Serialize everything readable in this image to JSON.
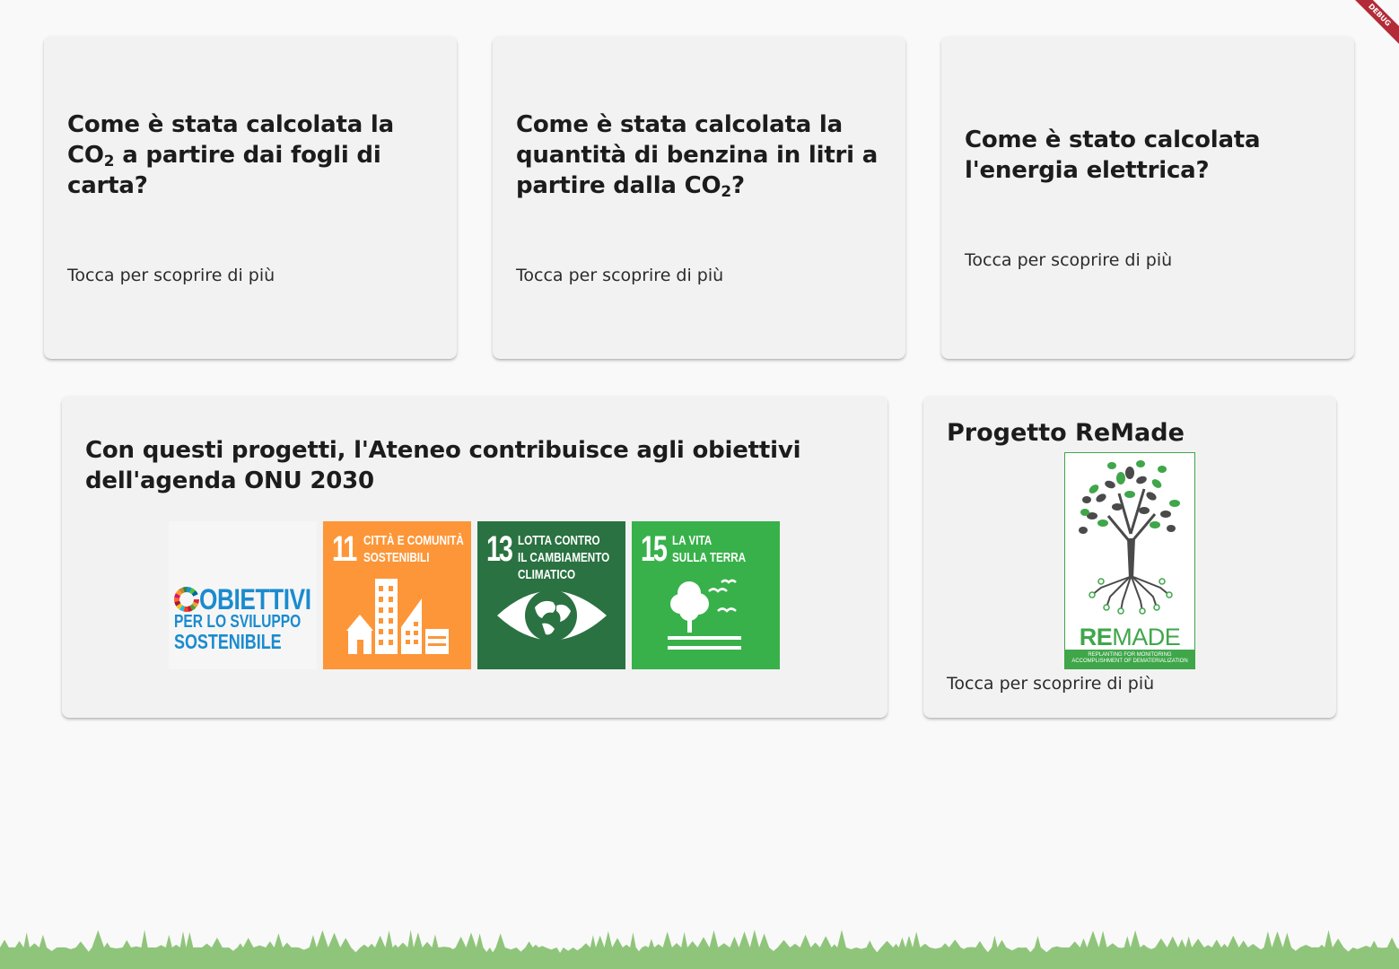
{
  "questions": [
    {
      "title": "Come è stata calcolata la CO",
      "subscript": "2",
      "title_rest": " a partire dai fogli di carta?",
      "cta": "Tocca per scoprire di più"
    },
    {
      "title": "Come è stata calcolata la quantità di benzina in litri a partire dalla CO",
      "subscript": "2",
      "title_rest": "?",
      "cta": "Tocca per scoprire di più"
    },
    {
      "title": "Come è stato calcolata l'energia elettrica?",
      "cta": "Tocca per scoprire di più"
    }
  ],
  "sdg": {
    "title": "Con questi progetti, l'Ateneo contribuisce agli obiettivi dell'agenda ONU 2030",
    "logo": {
      "line1": "OBIETTIVI",
      "line2": "PER LO SVILUPPO",
      "line3": "SOSTENIBILE"
    },
    "goals": [
      {
        "number": "11",
        "label1": "Città e comunità",
        "label2": "sostenibili",
        "color": "#fd9638",
        "icon": "city-icon"
      },
      {
        "number": "13",
        "label1": "Lotta contro",
        "label2": "il cambiamento",
        "label3": "climatico",
        "color": "#2a7241",
        "icon": "eye-globe-icon"
      },
      {
        "number": "15",
        "label1": "La vita",
        "label2": "sulla terra",
        "color": "#38b14a",
        "icon": "tree-birds-icon"
      }
    ]
  },
  "remade": {
    "title": "Progetto ReMade",
    "logo_word_bold": "RE",
    "logo_word_light": "MADE",
    "logo_tagline1": "Replanting for monitoring",
    "logo_tagline2": "accomplishment of dematerialization",
    "cta": "Tocca per scoprire di più"
  },
  "debug_banner": "DEBUG",
  "colors": {
    "grass": "#8fc57a",
    "card": "#f2f2f2",
    "background": "#f9f9f9",
    "remade_green": "#3fa64a"
  }
}
